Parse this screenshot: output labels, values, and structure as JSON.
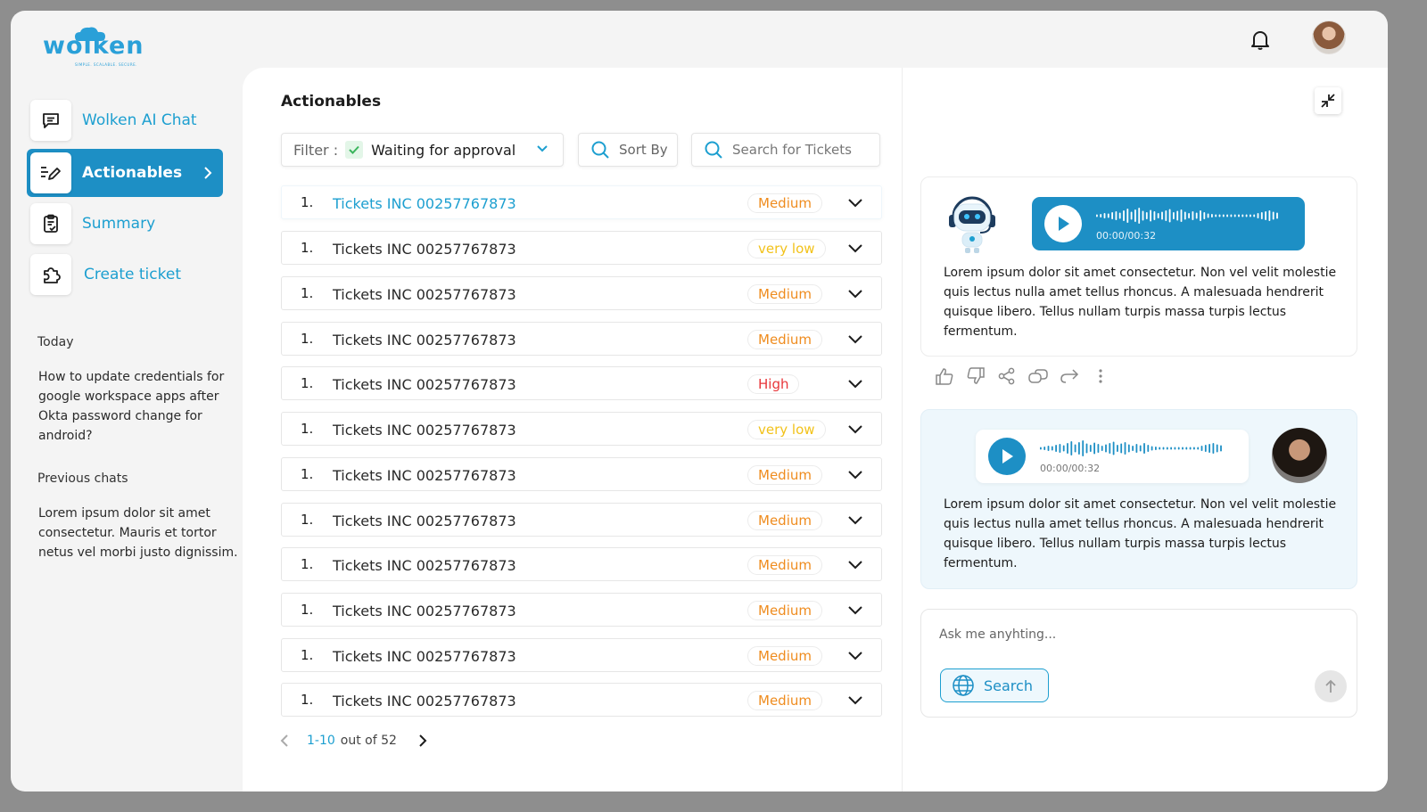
{
  "app": {
    "logo_text": "wolken",
    "logo_tagline": "SIMPLE. SCALABLE. SECURE."
  },
  "header": {
    "notifications_icon": "bell-icon",
    "profile_icon": "user-avatar"
  },
  "sidebar": {
    "nav": [
      {
        "label": "Wolken AI Chat",
        "icon": "chat-icon",
        "active": false
      },
      {
        "label": "Actionables",
        "icon": "edit-list-icon",
        "active": true
      },
      {
        "label": "Summary",
        "icon": "clipboard-icon",
        "active": false
      },
      {
        "label": "Create ticket",
        "icon": "puzzle-icon",
        "active": false
      }
    ],
    "today_heading": "Today",
    "today_chat": "How to update credentials for google workspace apps after Okta password change for android?",
    "previous_heading": "Previous chats",
    "previous_chat": "Lorem ipsum dolor sit amet consectetur. Mauris et tortor netus vel morbi justo dignissim."
  },
  "actionables": {
    "title": "Actionables",
    "filter_label": "Filter :",
    "filter_value": "Waiting for approval",
    "sort_label": "Sort By",
    "search_placeholder": "Search for Tickets",
    "tickets": [
      {
        "num": "1.",
        "name": "Tickets INC 00257767873",
        "priority": "Medium"
      },
      {
        "num": "1.",
        "name": "Tickets INC 00257767873",
        "priority": "very low"
      },
      {
        "num": "1.",
        "name": "Tickets INC 00257767873",
        "priority": "Medium"
      },
      {
        "num": "1.",
        "name": "Tickets INC 00257767873",
        "priority": "Medium"
      },
      {
        "num": "1.",
        "name": "Tickets INC 00257767873",
        "priority": "High"
      },
      {
        "num": "1.",
        "name": "Tickets INC 00257767873",
        "priority": "very low"
      },
      {
        "num": "1.",
        "name": "Tickets INC 00257767873",
        "priority": "Medium"
      },
      {
        "num": "1.",
        "name": "Tickets INC 00257767873",
        "priority": "Medium"
      },
      {
        "num": "1.",
        "name": "Tickets INC 00257767873",
        "priority": "Medium"
      },
      {
        "num": "1.",
        "name": "Tickets INC 00257767873",
        "priority": "Medium"
      },
      {
        "num": "1.",
        "name": "Tickets INC 00257767873",
        "priority": "Medium"
      },
      {
        "num": "1.",
        "name": "Tickets INC 00257767873",
        "priority": "Medium"
      }
    ],
    "priority_colors": {
      "Medium": "#ef8c1f",
      "very low": "#f2c21a",
      "High": "#e8363a"
    },
    "pager_range": "1-10",
    "pager_total": "out of 52"
  },
  "chat": {
    "bot_message": {
      "audio_time": "00:00/00:32",
      "text": "Lorem ipsum dolor sit amet consectetur. Non vel velit molestie quis lectus nulla amet tellus rhoncus. A malesuada hendrerit quisque libero. Tellus nullam turpis massa turpis lectus fermentum."
    },
    "user_message": {
      "audio_time": "00:00/00:32",
      "text": "Lorem ipsum dolor sit amet consectetur. Non vel velit molestie quis lectus nulla amet tellus rhoncus. A malesuada hendrerit quisque libero. Tellus nullam turpis massa turpis lectus fermentum."
    },
    "actions": [
      "thumbs-up-icon",
      "thumbs-down-icon",
      "share-icon",
      "copy-icon",
      "redo-icon",
      "more-icon"
    ],
    "composer_placeholder": "Ask me anyhting...",
    "search_label": "Search"
  },
  "colors": {
    "accent": "#1d8fc5",
    "accent_light": "#1d9fd0"
  }
}
